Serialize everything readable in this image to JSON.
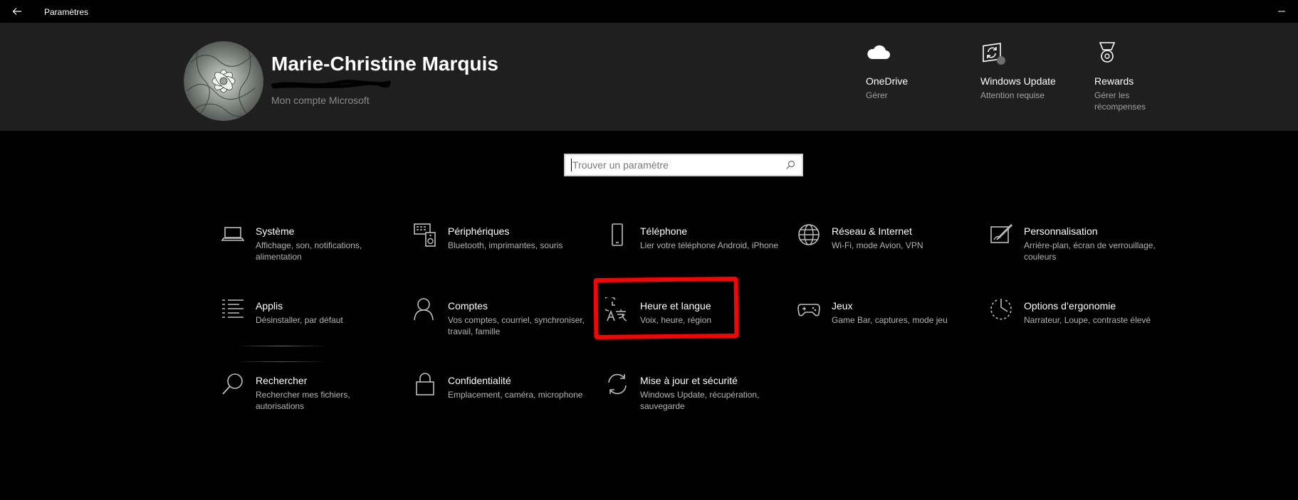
{
  "window": {
    "title": "Paramètres"
  },
  "account": {
    "name": "Marie-Christine Marquis",
    "link": "Mon compte Microsoft"
  },
  "quick_actions": [
    {
      "title": "OneDrive",
      "subtitle": "Gérer",
      "icon": "onedrive-cloud-icon"
    },
    {
      "title": "Windows Update",
      "subtitle": "Attention requise",
      "icon": "windows-update-icon"
    },
    {
      "title": "Rewards",
      "subtitle": "Gérer les récompenses",
      "icon": "rewards-medal-icon"
    }
  ],
  "search": {
    "placeholder": "Trouver un paramètre"
  },
  "categories": [
    {
      "title": "Système",
      "desc": "Affichage, son, notifications, alimentation",
      "icon": "laptop-icon"
    },
    {
      "title": "Périphériques",
      "desc": "Bluetooth, imprimantes, souris",
      "icon": "devices-icon"
    },
    {
      "title": "Téléphone",
      "desc": "Lier votre téléphone Android, iPhone",
      "icon": "phone-icon"
    },
    {
      "title": "Réseau & Internet",
      "desc": "Wi-Fi, mode Avion, VPN",
      "icon": "globe-icon"
    },
    {
      "title": "Personnalisation",
      "desc": "Arrière-plan, écran de verrouillage, couleurs",
      "icon": "personalization-icon"
    },
    {
      "title": "Applis",
      "desc": "Désinstaller, par défaut",
      "icon": "apps-list-icon"
    },
    {
      "title": "Comptes",
      "desc": "Vos comptes, courriel, synchroniser, travail, famille",
      "icon": "person-icon"
    },
    {
      "title": "Heure et langue",
      "desc": "Voix, heure, région",
      "icon": "time-language-icon"
    },
    {
      "title": "Jeux",
      "desc": "Game Bar, captures, mode jeu",
      "icon": "gamepad-icon"
    },
    {
      "title": "Options d’ergonomie",
      "desc": "Narrateur, Loupe, contraste élevé",
      "icon": "ease-of-access-icon"
    },
    {
      "title": "Rechercher",
      "desc": "Rechercher mes fichiers, autorisations",
      "icon": "search-icon"
    },
    {
      "title": "Confidentialité",
      "desc": "Emplacement, caméra, microphone",
      "icon": "lock-icon"
    },
    {
      "title": "Mise à jour et sécurité",
      "desc": "Windows Update, récupération, sauvegarde",
      "icon": "sync-icon"
    }
  ],
  "colors": {
    "background": "#000000",
    "header": "#1f1f1f",
    "highlight": "#ff0000",
    "secondary_text": "#b3b3b3"
  }
}
